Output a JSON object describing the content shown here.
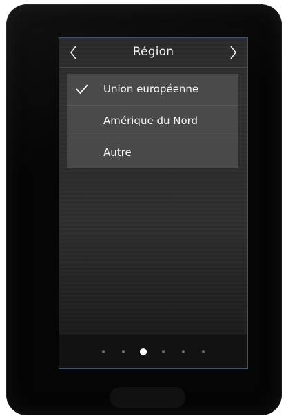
{
  "header": {
    "title": "Région",
    "prev_icon": "chevron-left-icon",
    "next_icon": "chevron-right-icon"
  },
  "region_list": {
    "selected_index": 0,
    "items": [
      {
        "label": "Union européenne",
        "selected": true
      },
      {
        "label": "Amérique du Nord",
        "selected": false
      },
      {
        "label": "Autre",
        "selected": false
      }
    ]
  },
  "pager": {
    "page_count": 6,
    "current_page": 3
  },
  "colors": {
    "screen_border": "#3b5572",
    "item_background": "#525252",
    "text": "#f5f5f5",
    "active_dot": "#ffffff",
    "inactive_dot": "#6b6b6b"
  }
}
